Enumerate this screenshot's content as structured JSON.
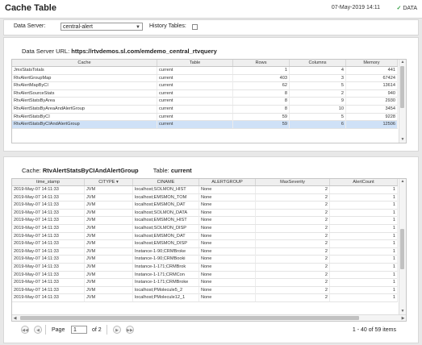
{
  "header": {
    "title": "Cache Table",
    "datetime": "07-May-2019 14:11",
    "status": "DATA"
  },
  "filters": {
    "data_server_label": "Data Server:",
    "data_server_value": "central-alert",
    "history_label": "History Tables:"
  },
  "cache_panel": {
    "url_label": "Data Server URL:",
    "url_value": "https://rtvdemos.sl.com/emdemo_central_rtvquery",
    "columns": [
      "Cache",
      "Table",
      "Rows",
      "Columns",
      "Memory"
    ],
    "rows": [
      [
        "JmxStatsTotals",
        "current",
        "1",
        "4",
        "441"
      ],
      [
        "RtvAlertGroupMap",
        "current",
        "403",
        "3",
        "67424"
      ],
      [
        "RtvAlertMapByCI",
        "current",
        "62",
        "5",
        "13614"
      ],
      [
        "RtvAlertSourceStats",
        "current",
        "8",
        "2",
        "940"
      ],
      [
        "RtvAlertStatsByArea",
        "current",
        "8",
        "9",
        "2930"
      ],
      [
        "RtvAlertStatsByAreaAndAlertGroup",
        "current",
        "8",
        "10",
        "3454"
      ],
      [
        "RtvAlertStatsByCI",
        "current",
        "59",
        "5",
        "9228"
      ],
      [
        "RtvAlertStatsByCIAndAlertGroup",
        "current",
        "59",
        "6",
        "12506"
      ]
    ]
  },
  "detail_panel": {
    "cache_label": "Cache:",
    "cache_value": "RtvAlertStatsByCIAndAlertGroup",
    "table_label": "Table:",
    "table_value": "current",
    "columns": [
      "time_stamp",
      "CITYPE ▾",
      "CINAME",
      "ALERTGROUP",
      "MaxSeverity",
      "AlertCount"
    ],
    "rows": [
      [
        "2019-May-07 14:11:33",
        "JVM",
        "localhost;SOLMON_HIST",
        "None",
        "2",
        "1"
      ],
      [
        "2019-May-07 14:11:33",
        "JVM",
        "localhost;EMSMON_TOM",
        "None",
        "2",
        "1"
      ],
      [
        "2019-May-07 14:11:33",
        "JVM",
        "localhost;EMSMON_DAT",
        "None",
        "2",
        "1"
      ],
      [
        "2019-May-07 14:11:33",
        "JVM",
        "localhost;SOLMON_DATA",
        "None",
        "2",
        "1"
      ],
      [
        "2019-May-07 14:11:33",
        "JVM",
        "localhost;EMSMON_HIST",
        "None",
        "2",
        "1"
      ],
      [
        "2019-May-07 14:11:33",
        "JVM",
        "localhost;SOLMON_DISP",
        "None",
        "2",
        "1"
      ],
      [
        "2019-May-07 14:11:33",
        "JVM",
        "localhost;EMSMON_DAT",
        "None",
        "2",
        "1"
      ],
      [
        "2019-May-07 14:11:33",
        "JVM",
        "localhost;EMSMON_DISP",
        "None",
        "2",
        "1"
      ],
      [
        "2019-May-07 14:11:33",
        "JVM",
        "Instance-1-90;CRMBroke",
        "None",
        "2",
        "1"
      ],
      [
        "2019-May-07 14:11:33",
        "JVM",
        "Instance-1-90;CRMBooki",
        "None",
        "2",
        "1"
      ],
      [
        "2019-May-07 14:11:33",
        "JVM",
        "Instance-1-171;CRMBrok",
        "None",
        "2",
        "1"
      ],
      [
        "2019-May-07 14:11:33",
        "JVM",
        "Instance-1-171;CRMCon",
        "None",
        "2",
        "1"
      ],
      [
        "2019-May-07 14:11:33",
        "JVM",
        "Instance-1-171;CRMBroke",
        "None",
        "2",
        "1"
      ],
      [
        "2019-May-07 14:11:33",
        "JVM",
        "localhost;PMolecule5_2",
        "None",
        "2",
        "1"
      ],
      [
        "2019-May-07 14:11:33",
        "JVM",
        "localhost;PMolecule12_1",
        "None",
        "2",
        "1"
      ]
    ]
  },
  "pager": {
    "page_label": "Page",
    "page_value": "1",
    "of_label": "of 2",
    "summary": "1 - 40 of 59 items"
  },
  "icons": {
    "first": "first-page-icon",
    "prev": "prev-page-icon",
    "next": "next-page-icon",
    "last": "last-page-icon",
    "check": "check-icon"
  }
}
